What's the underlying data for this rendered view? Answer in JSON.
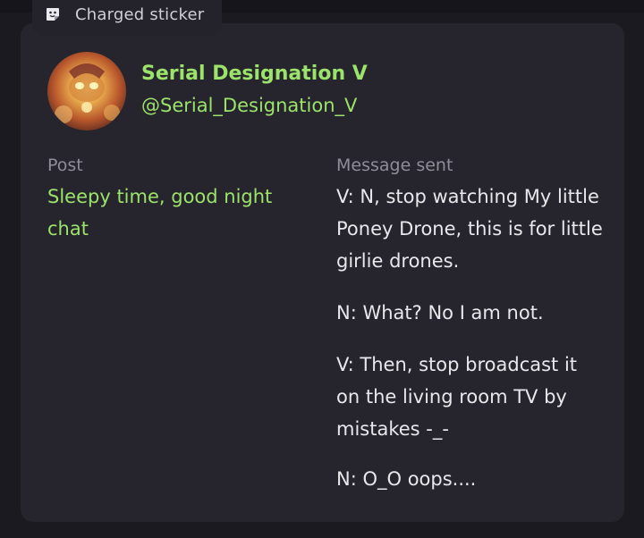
{
  "sticker": {
    "label": "Charged sticker",
    "icon": "sticker-icon"
  },
  "profile": {
    "display_name": "Serial Designation V",
    "handle": "@Serial_Designation_V",
    "name_color": "#9be36a"
  },
  "post": {
    "label": "Post",
    "text": "Sleepy time, good night chat"
  },
  "message": {
    "label": "Message sent",
    "lines": [
      "V: N, stop watching My little Poney Drone, this is for little girlie drones.",
      "N: What? No I am not.",
      "V: Then, stop broadcast it on the living room TV by mistakes -_-",
      "N: O_O oops...."
    ]
  }
}
